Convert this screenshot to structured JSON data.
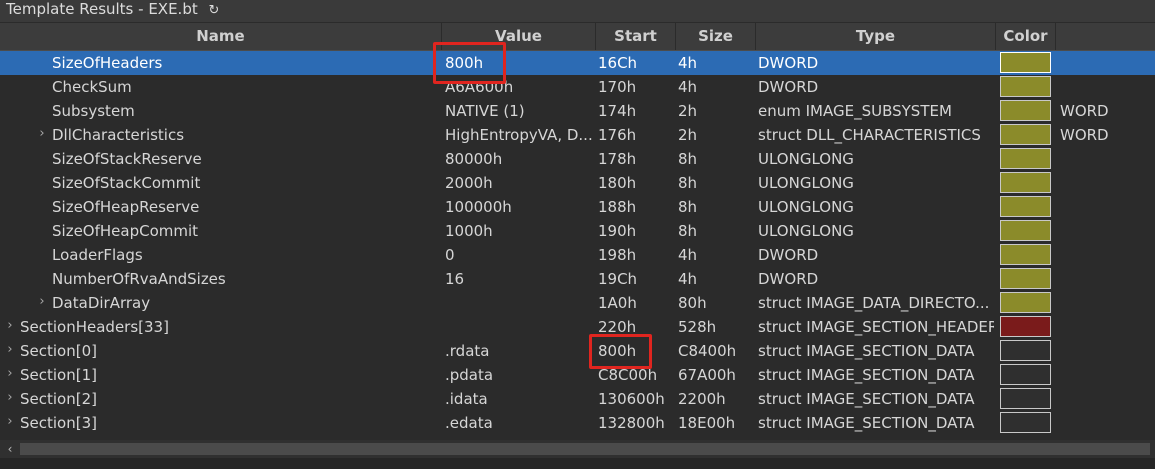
{
  "window": {
    "title": "Template Results - EXE.bt",
    "refresh_icon": "refresh-icon"
  },
  "columns": [
    "Name",
    "Value",
    "Start",
    "Size",
    "Type",
    "Color"
  ],
  "colors": {
    "selected_row": "#2c6bb4",
    "olive": "#8b8b2a",
    "dark_red": "#7a1b1b",
    "dark": "#2f2f2f",
    "highlight": "#e0251f"
  },
  "rows": [
    {
      "name": "SizeOfHeaders",
      "value": "800h",
      "start": "16Ch",
      "size": "4h",
      "type": "DWORD",
      "swatch": "#8b8b2a",
      "extra": "",
      "selected": true
    },
    {
      "name": "CheckSum",
      "value": "A6A600h",
      "start": "170h",
      "size": "4h",
      "type": "DWORD",
      "swatch": "#8b8b2a",
      "extra": ""
    },
    {
      "name": "Subsystem",
      "value": "NATIVE (1)",
      "start": "174h",
      "size": "2h",
      "type": "enum IMAGE_SUBSYSTEM",
      "swatch": "#8b8b2a",
      "extra": "WORD"
    },
    {
      "name": "DllCharacteristics",
      "value": "HighEntropyVA, D...",
      "start": "176h",
      "size": "2h",
      "type": "struct DLL_CHARACTERISTICS",
      "swatch": "#8b8b2a",
      "extra": "WORD",
      "expandable": true
    },
    {
      "name": "SizeOfStackReserve",
      "value": "80000h",
      "start": "178h",
      "size": "8h",
      "type": "ULONGLONG",
      "swatch": "#8b8b2a",
      "extra": ""
    },
    {
      "name": "SizeOfStackCommit",
      "value": "2000h",
      "start": "180h",
      "size": "8h",
      "type": "ULONGLONG",
      "swatch": "#8b8b2a",
      "extra": ""
    },
    {
      "name": "SizeOfHeapReserve",
      "value": "100000h",
      "start": "188h",
      "size": "8h",
      "type": "ULONGLONG",
      "swatch": "#8b8b2a",
      "extra": ""
    },
    {
      "name": "SizeOfHeapCommit",
      "value": "1000h",
      "start": "190h",
      "size": "8h",
      "type": "ULONGLONG",
      "swatch": "#8b8b2a",
      "extra": ""
    },
    {
      "name": "LoaderFlags",
      "value": "0",
      "start": "198h",
      "size": "4h",
      "type": "DWORD",
      "swatch": "#8b8b2a",
      "extra": ""
    },
    {
      "name": "NumberOfRvaAndSizes",
      "value": "16",
      "start": "19Ch",
      "size": "4h",
      "type": "DWORD",
      "swatch": "#8b8b2a",
      "extra": ""
    },
    {
      "name": "DataDirArray",
      "value": "",
      "start": "1A0h",
      "size": "80h",
      "type": "struct IMAGE_DATA_DIRECTO...",
      "swatch": "#8b8b2a",
      "extra": "",
      "expandable": true
    },
    {
      "name": "SectionHeaders[33]",
      "value": "",
      "start": "220h",
      "size": "528h",
      "type": "struct IMAGE_SECTION_HEADER",
      "swatch": "#7a1b1b",
      "extra": "",
      "expandable": true,
      "top": true
    },
    {
      "name": "Section[0]",
      "value": ".rdata",
      "start": "800h",
      "size": "C8400h",
      "type": "struct IMAGE_SECTION_DATA",
      "swatch": "#2f2f2f",
      "extra": "",
      "expandable": true,
      "top": true
    },
    {
      "name": "Section[1]",
      "value": ".pdata",
      "start": "C8C00h",
      "size": "67A00h",
      "type": "struct IMAGE_SECTION_DATA",
      "swatch": "#2f2f2f",
      "extra": "",
      "expandable": true,
      "top": true
    },
    {
      "name": "Section[2]",
      "value": ".idata",
      "start": "130600h",
      "size": "2200h",
      "type": "struct IMAGE_SECTION_DATA",
      "swatch": "#2f2f2f",
      "extra": "",
      "expandable": true,
      "top": true
    },
    {
      "name": "Section[3]",
      "value": ".edata",
      "start": "132800h",
      "size": "18E00h",
      "type": "struct IMAGE_SECTION_DATA",
      "swatch": "#2f2f2f",
      "extra": "",
      "expandable": true,
      "top": true
    }
  ],
  "scrollbar": {
    "left_arrow": "‹"
  }
}
